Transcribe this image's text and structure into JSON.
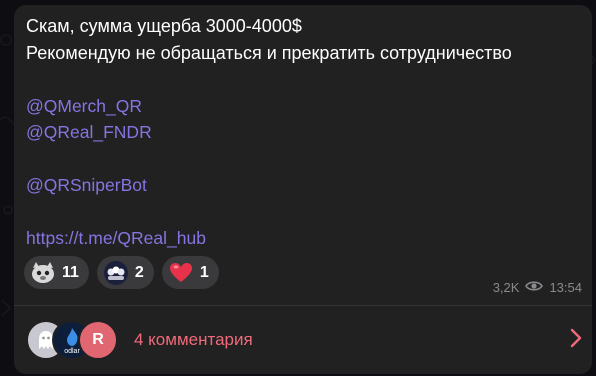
{
  "message": {
    "lines": [
      "Скам, сумма ущерба 3000-4000$",
      "Рекомендую не обращаться и прекратить сотрудничество"
    ],
    "mentions": [
      "@QMerch_QR",
      "@QReal_FNDR",
      "@QRSniperBot"
    ],
    "link": "https://t.me/QReal_hub"
  },
  "reactions": [
    {
      "emoji": "cat-face-emoji",
      "count": "11"
    },
    {
      "emoji": "crowd-emoji",
      "count": "2"
    },
    {
      "emoji": "heart-emoji",
      "count": "1"
    }
  ],
  "meta": {
    "views": "3,2K",
    "time": "13:54"
  },
  "comments": {
    "label": "4 комментария",
    "avatar_letter": "R",
    "avatar_text": "odlar"
  },
  "colors": {
    "bubble": "#212121",
    "link": "#8774e1",
    "comments": "#ef6a7b",
    "meta": "#8a8a8e"
  }
}
